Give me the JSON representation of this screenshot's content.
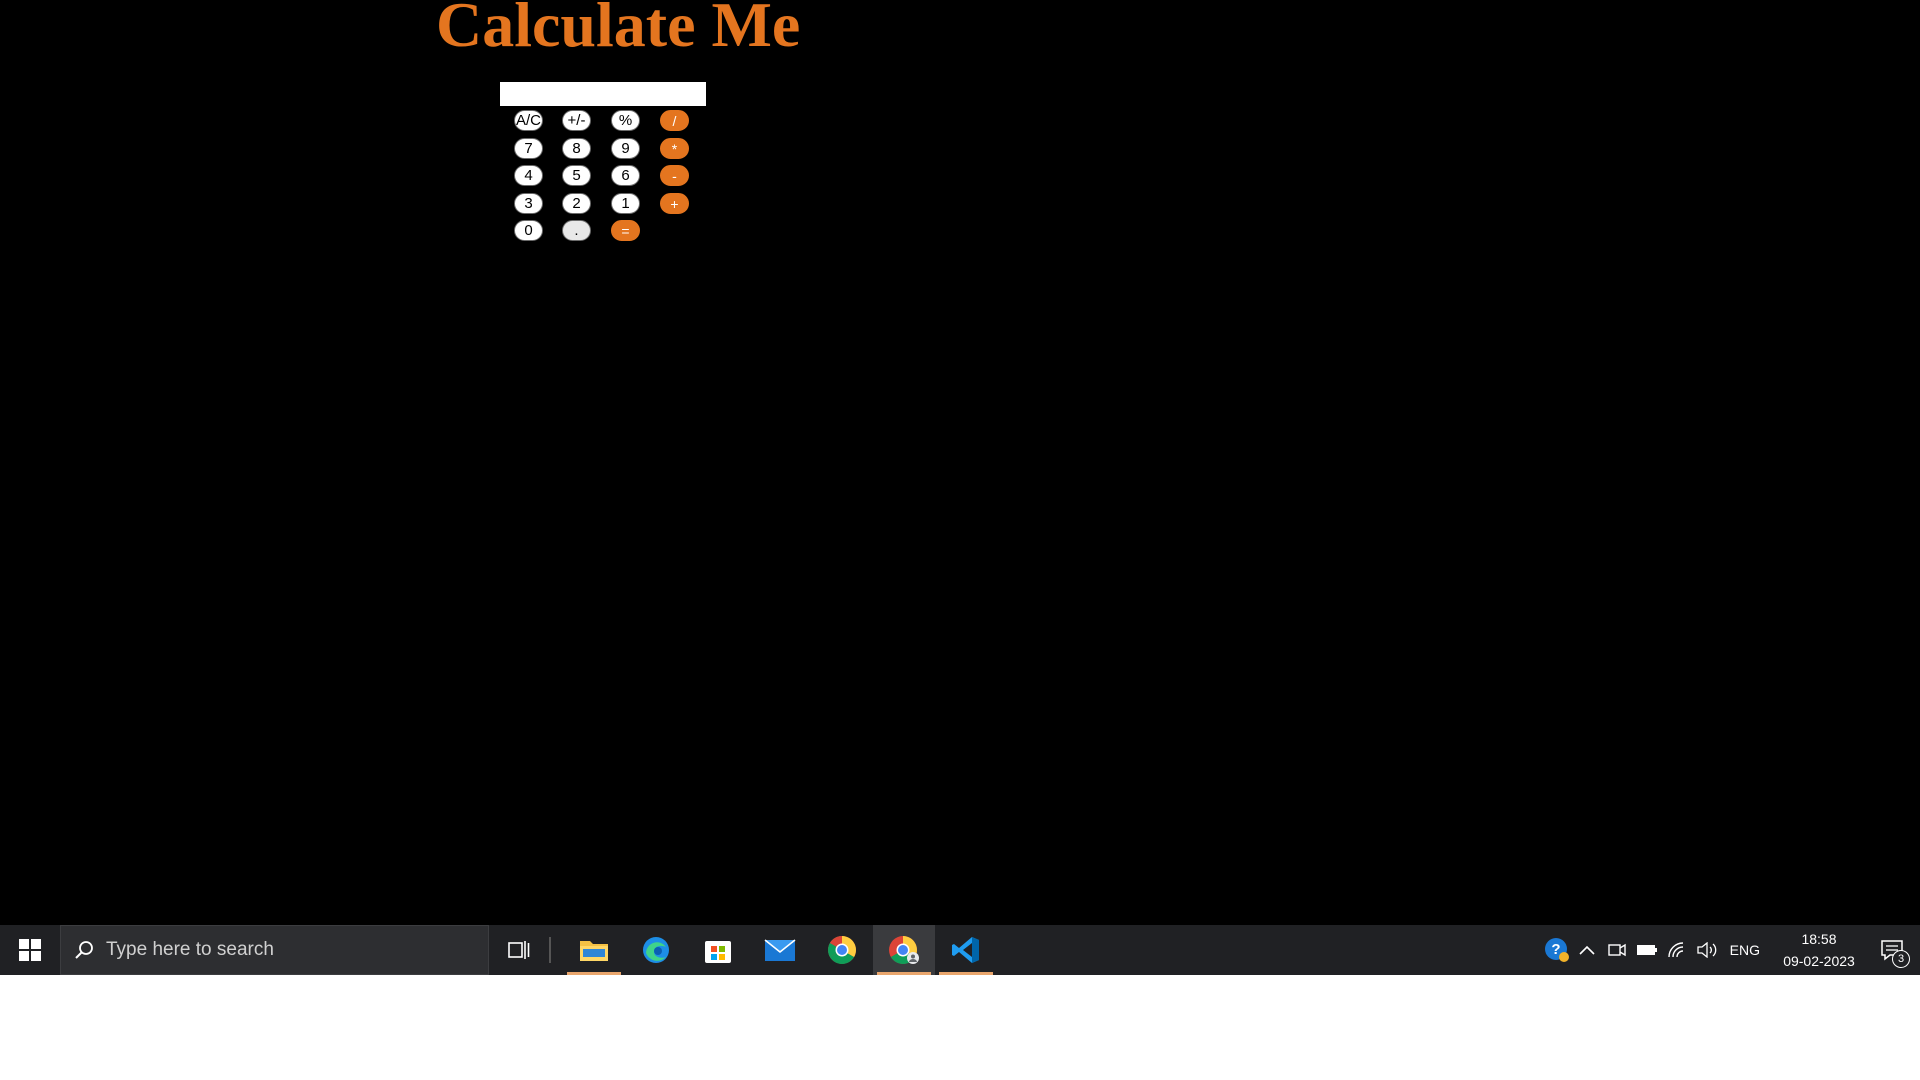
{
  "page": {
    "title": "Calculate Me",
    "accent_color": "#e4751f",
    "background_color": "#000000"
  },
  "calculator": {
    "display_value": "",
    "keys": [
      {
        "label": "A/C",
        "style": "white"
      },
      {
        "label": "+/-",
        "style": "white"
      },
      {
        "label": "%",
        "style": "white"
      },
      {
        "label": "/",
        "style": "orange"
      },
      {
        "label": "7",
        "style": "white"
      },
      {
        "label": "8",
        "style": "white"
      },
      {
        "label": "9",
        "style": "white"
      },
      {
        "label": "*",
        "style": "orange"
      },
      {
        "label": "4",
        "style": "white"
      },
      {
        "label": "5",
        "style": "white"
      },
      {
        "label": "6",
        "style": "white"
      },
      {
        "label": "-",
        "style": "orange"
      },
      {
        "label": "3",
        "style": "white"
      },
      {
        "label": "2",
        "style": "white"
      },
      {
        "label": "1",
        "style": "white"
      },
      {
        "label": "+",
        "style": "orange"
      },
      {
        "label": "0",
        "style": "white"
      },
      {
        "label": ".",
        "style": "gray"
      },
      {
        "label": "=",
        "style": "orange"
      }
    ]
  },
  "taskbar": {
    "search_placeholder": "Type here to search",
    "apps": [
      {
        "name": "file-explorer",
        "running": true,
        "active": false
      },
      {
        "name": "edge",
        "running": false,
        "active": false
      },
      {
        "name": "microsoft-store",
        "running": false,
        "active": false
      },
      {
        "name": "mail",
        "running": false,
        "active": false
      },
      {
        "name": "chrome",
        "running": false,
        "active": false
      },
      {
        "name": "chrome-profile",
        "running": true,
        "active": true
      },
      {
        "name": "vscode",
        "running": true,
        "active": false
      }
    ],
    "tray": {
      "language": "ENG",
      "time": "18:58",
      "date": "09-02-2023",
      "notification_count": "3"
    }
  }
}
